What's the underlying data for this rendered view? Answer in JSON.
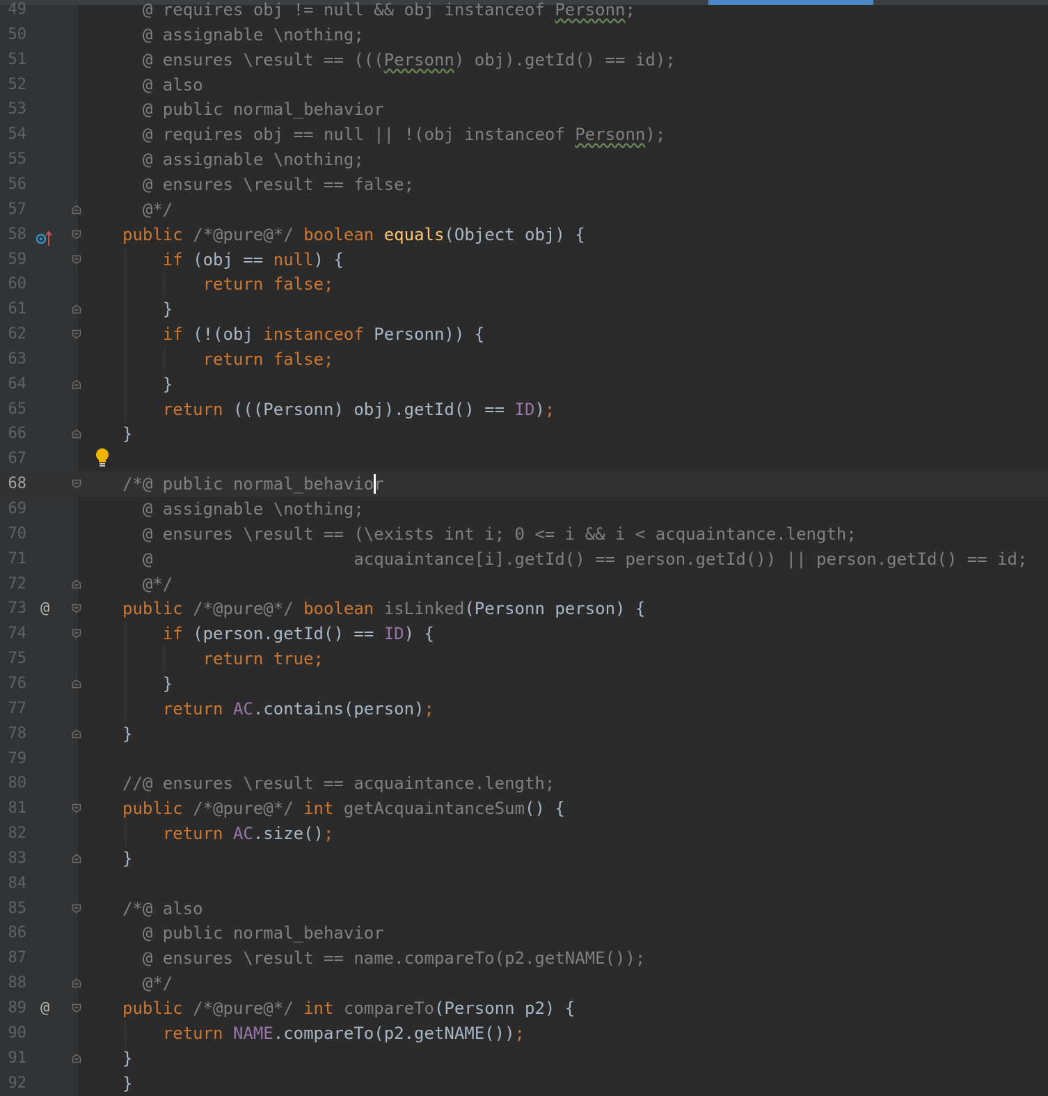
{
  "editor": {
    "gutter_icons": {
      "line58_override": "override-implements-icon",
      "line73_annotation": "@",
      "line89_annotation": "@",
      "line67_hint": "lightbulb-icon"
    },
    "lines": [
      {
        "n": "49",
        "html": "<span class=\"cm\">  @ requires obj != null &amp;&amp; obj instanceof <span class=\"sq\">Personn</span>;</span>"
      },
      {
        "n": "50",
        "html": "<span class=\"cm\">  @ assignable \\nothing;</span>"
      },
      {
        "n": "51",
        "html": "<span class=\"cm\">  @ ensures \\result == (((<span class=\"sq\">Personn</span>) obj).getId() == id);</span>"
      },
      {
        "n": "52",
        "html": "<span class=\"cm\">  @ also</span>"
      },
      {
        "n": "53",
        "html": "<span class=\"cm\">  @ public normal_behavior</span>"
      },
      {
        "n": "54",
        "html": "<span class=\"cm\">  @ requires obj == null || !(obj instanceof <span class=\"sq\">Personn</span>);</span>"
      },
      {
        "n": "55",
        "html": "<span class=\"cm\">  @ assignable \\nothing;</span>"
      },
      {
        "n": "56",
        "html": "<span class=\"cm\">  @ ensures \\result == false;</span>"
      },
      {
        "n": "57",
        "html": "<span class=\"cm\">  @*/</span>"
      },
      {
        "n": "58",
        "html": "<span class=\"kw\">public</span> <span class=\"cm\">/*@pure@*/</span> <span class=\"kw\">boolean</span> <span class=\"mt\">equals</span>(Object obj) {"
      },
      {
        "n": "59",
        "html": "    <span class=\"kw\">if</span> (obj == <span class=\"kw\">null</span>) {"
      },
      {
        "n": "60",
        "html": "        <span class=\"kw\">return false;</span>"
      },
      {
        "n": "61",
        "html": "    }"
      },
      {
        "n": "62",
        "html": "    <span class=\"kw\">if</span> (!(obj <span class=\"kw\">instanceof</span> Personn)) {"
      },
      {
        "n": "63",
        "html": "        <span class=\"kw\">return false;</span>"
      },
      {
        "n": "64",
        "html": "    }"
      },
      {
        "n": "65",
        "html": "    <span class=\"kw\">return</span> (((Personn) obj).getId() == <span class=\"fd\">ID</span>)<span class=\"kw\">;</span>"
      },
      {
        "n": "66",
        "html": "}"
      },
      {
        "n": "67",
        "html": ""
      },
      {
        "n": "68",
        "html": "<span class=\"cm\">/*@ public normal_behavior</span>"
      },
      {
        "n": "69",
        "html": "<span class=\"cm\">  @ assignable \\nothing;</span>"
      },
      {
        "n": "70",
        "html": "<span class=\"cm\">  @ ensures \\result == (\\exists int i; 0 &lt;= i &amp;&amp; i &lt; acquaintance.length;</span>"
      },
      {
        "n": "71",
        "html": "<span class=\"cm\">  @                    acquaintance[i].getId() == person.getId()) || person.getId() == id;</span>"
      },
      {
        "n": "72",
        "html": "<span class=\"cm\">  @*/</span>"
      },
      {
        "n": "73",
        "html": "<span class=\"kw\">public</span> <span class=\"cm\">/*@pure@*/</span> <span class=\"kw\">boolean</span> <span class=\"un\">isLinked</span>(Personn person) {"
      },
      {
        "n": "74",
        "html": "    <span class=\"kw\">if</span> (person.getId() == <span class=\"fd\">ID</span>) {"
      },
      {
        "n": "75",
        "html": "        <span class=\"kw\">return true;</span>"
      },
      {
        "n": "76",
        "html": "    }"
      },
      {
        "n": "77",
        "html": "    <span class=\"kw\">return</span> <span class=\"fd\">AC</span>.contains(person)<span class=\"kw\">;</span>"
      },
      {
        "n": "78",
        "html": "}"
      },
      {
        "n": "79",
        "html": ""
      },
      {
        "n": "80",
        "html": "<span class=\"cm\">//@ ensures \\result == acquaintance.length;</span>"
      },
      {
        "n": "81",
        "html": "<span class=\"kw\">public</span> <span class=\"cm\">/*@pure@*/</span> <span class=\"kw\">int</span> <span class=\"un\">getAcquaintanceSum</span>() {"
      },
      {
        "n": "82",
        "html": "    <span class=\"kw\">return</span> <span class=\"fd\">AC</span>.size()<span class=\"kw\">;</span>"
      },
      {
        "n": "83",
        "html": "}"
      },
      {
        "n": "84",
        "html": ""
      },
      {
        "n": "85",
        "html": "<span class=\"cm\">/*@ also</span>"
      },
      {
        "n": "86",
        "html": "<span class=\"cm\">  @ public normal_behavior</span>"
      },
      {
        "n": "87",
        "html": "<span class=\"cm\">  @ ensures \\result == name.compareTo(p2.getNAME());</span>"
      },
      {
        "n": "88",
        "html": "<span class=\"cm\">  @*/</span>"
      },
      {
        "n": "89",
        "html": "<span class=\"kw\">public</span> <span class=\"cm\">/*@pure@*/</span> <span class=\"kw\">int</span> <span class=\"un\">compareTo</span>(Personn p2) {"
      },
      {
        "n": "90",
        "html": "    <span class=\"kw\">return</span> <span class=\"fd\">NAME</span>.compareTo(p2.getNAME())<span class=\"kw\">;</span>"
      },
      {
        "n": "91",
        "html": "}"
      },
      {
        "n": "92",
        "html": "}"
      }
    ],
    "current_line": "68",
    "colors": {
      "background": "#2b2b2b",
      "gutter": "#313335",
      "keyword": "#cc7832",
      "comment": "#808080",
      "method": "#ffc66d",
      "field": "#9876aa",
      "text": "#a9b7c6",
      "scroll_indicator": "#4a88c7"
    }
  }
}
